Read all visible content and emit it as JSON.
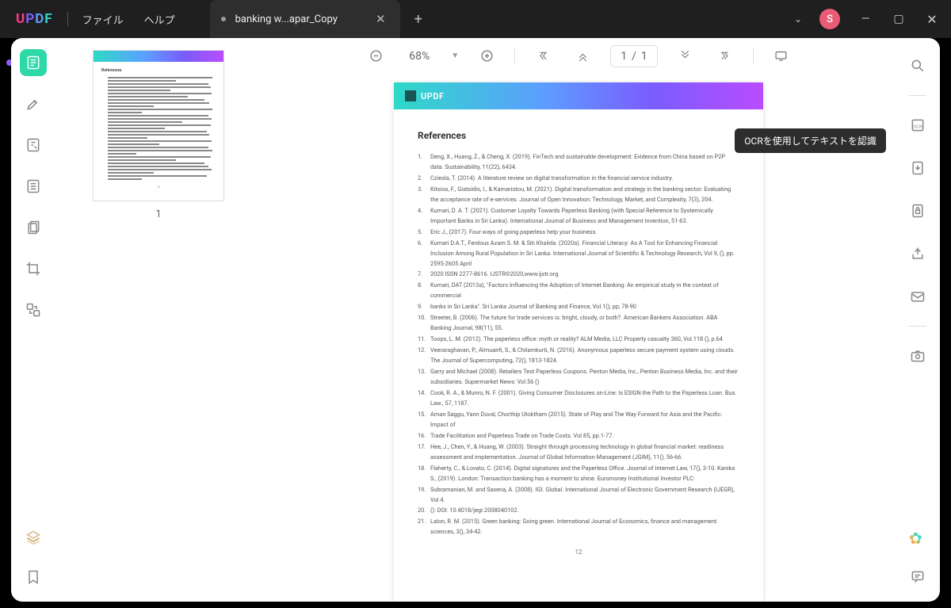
{
  "app": {
    "logo": "UPDF"
  },
  "menu": {
    "file": "ファイル",
    "help": "ヘルプ"
  },
  "tab": {
    "title": "banking w...apar_Copy"
  },
  "titlebar": {
    "avatar": "S"
  },
  "toolbar": {
    "zoom": "68%",
    "page_current": "1",
    "page_sep": "/",
    "page_total": "1"
  },
  "tooltip": {
    "ocr": "OCRを使用してテキストを認識"
  },
  "thumb": {
    "number": "1"
  },
  "doc": {
    "brand": "UPDF",
    "title": "References",
    "page_number": "12",
    "refs": [
      "Deng, X., Huang, Z., & Cheng, X. (2019). FinTech and sustainable development: Evidence from China based on P2P data. Sustainability, 11(22), 6434.",
      "Cziesla, T. (2014). A literature review on digital transformation in the financial service industry.",
      "Kitsios, F., Giatsidis, I., & Kamariotou, M. (2021). Digital transformation and strategy in the banking sector: Evaluating the acceptance rate of e-services. Journal of Open Innovation: Technology, Market, and Complexity, 7(3), 204.",
      "Kumari, D. A. T. (2021). Customer Loyalty Towards Paperless Banking (with Special Reference to Systemically Important Banks in Sri Lanka). International Journal of Business and Management Invention, 51-63.",
      "Eric J., (2017). Four ways of going paperless help your business.",
      "Kumari D.A.T., Ferdous Azam S. M. & Siti Khalida. (2020a). Financial Literacy: As A Tool for Enhancing Financial Inclusion Among Rural Population in Sri Lanka. International Journal of Scientific & Technology Research, Vol 9, (), pp. 2595-2605 April",
      "2020 ISSN 2277-8616. IJSTR©2020,www.ijstr.org",
      "Kumari, DAT (2013a), \"Factors Influencing the Adoption of Internet Banking: An empirical study in the context of commercial",
      "banks in Sri Lanka\". Sri Lanka Journal of Banking and Finance, Vol.1(), pp, 78-90",
      "Streeter, B. (2006). The future for trade services is: bright, cloudy, or both?. American Bankers Association. ABA Banking Journal, 98(11), 55.",
      "Toops, L. M. (2012). The paperless office: myth or reality? ALM Media, LLC Property casualty 360, Vol.118 (), p.64",
      "Veeraraghavan, P., Almuairfi, S., & Chilamkurti, N. (2016). Anonymous paperless secure payment system using clouds. The Journal of Supercomputing, 72(), 1813-1824.",
      "Garry and Michael (2008). Retailers Test Paperless Coupons. Penton Media, Inc., Penton Business Media, Inc. and their subsidiaries. Supermarket News: Vol.56 ()",
      "Cook, R. A., & Munro, N. F. (2001). Giving Consumer Disclosures on-Line: Is ESIGN the Path to the Paperless Loan. Bus. Law., 57, 1187.",
      "Aman Saggu, Yann Duval, Chorthip Utoktham (2015). State of Play and The Way Forward for Asia and the Pacific: Impact of",
      "Trade Facilitation and Paperless Trade on Trade Costs. Vol 85, pp.1-77.",
      "Hee, J., Chen, Y., & Huang, W. (2003). Straight through processing technology in global financial market: readiness assessment and implementation. Journal of Global Information Management (JGIM), 11(), 56-66.",
      "Flaherty, C., & Lovato, C. (2014). Digital signatures and the Paperless Office. Journal of Internet Law, 17(), 3-10. Kanika S., (2019). London: Transaction banking has a moment to shine. Euromoney Institutional Investor PLC:",
      "Subramanian, M. and Saxena, A. (2008). IGI. Global. International Journal of Electronic Government Research (IJEGR), Vol 4.",
      "(): DOI: 10.4018/jegr.2008040102.",
      "Lalon, R. M. (2015). Green banking: Going green. International Journal of Economics, finance and management sciences, 3(), 34-42."
    ]
  }
}
